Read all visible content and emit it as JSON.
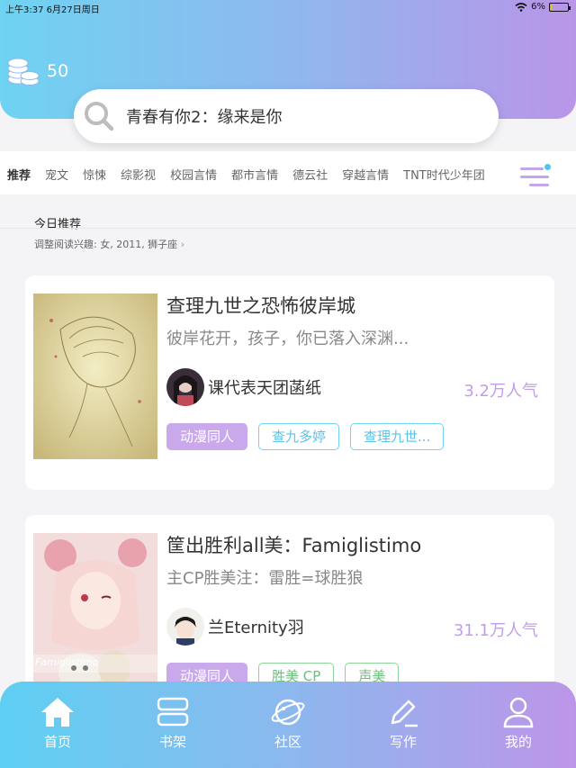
{
  "status": {
    "time": "上午3:37",
    "date": "6月27日周日",
    "battery": "6%",
    "battery_level": 0.06
  },
  "header": {
    "coins": "50",
    "search_text": "青春有你2：缘来是你"
  },
  "categories": [
    "推荐",
    "宠文",
    "惊悚",
    "综影视",
    "校园言情",
    "都市言情",
    "德云社",
    "穿越言情",
    "TNT时代少年团"
  ],
  "section": {
    "title": "今日推荐",
    "subtitle": "调整阅读兴趣: 女, 2011, 狮子座"
  },
  "books": [
    {
      "title": "查理九世之恐怖彼岸城",
      "desc": "彼岸花开，孩子，你已落入深渊...",
      "author": "课代表天团菡纸",
      "popularity": "3.2万人气",
      "tags": [
        "动漫同人",
        "查九多婷",
        "查理九世..."
      ]
    },
    {
      "title": "筐出胜利all美：Famiglistimo",
      "desc": "主CP胜美注：雷胜=球胜狼",
      "author": "兰Eternity羽",
      "popularity": "31.1万人气",
      "cover_text": "Famiglistimo",
      "tags": [
        "动漫同人",
        "胜美 CP",
        "声美"
      ]
    }
  ],
  "nav": [
    {
      "label": "首页",
      "icon": "home-icon"
    },
    {
      "label": "书架",
      "icon": "bookshelf-icon"
    },
    {
      "label": "社区",
      "icon": "planet-icon"
    },
    {
      "label": "写作",
      "icon": "pen-icon"
    },
    {
      "label": "我的",
      "icon": "user-icon"
    }
  ],
  "colors": {
    "gradient_start": "#6fd3f2",
    "gradient_end": "#b995e8",
    "accent_purple": "#c29ee8",
    "tag_blue": "#6fd3f2",
    "tag_green": "#8ad49a"
  }
}
